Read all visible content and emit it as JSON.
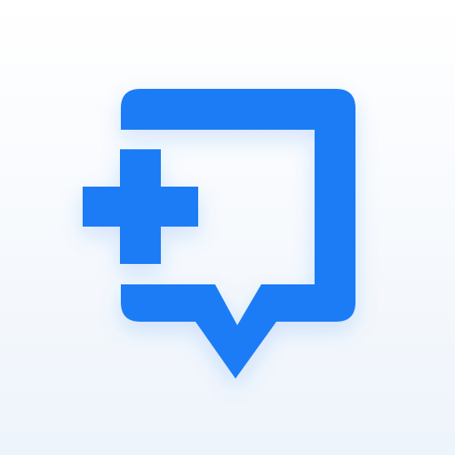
{
  "app_icon": {
    "icon": "medical-chat-bubble-icon",
    "parts": [
      "speech-bubble-icon",
      "plus-cross-icon"
    ],
    "colors": {
      "symbol": "#1a7cf5",
      "background_top": "#ffffff",
      "background_bottom": "#eef4fb",
      "shadow": "#1a7cf5"
    }
  }
}
